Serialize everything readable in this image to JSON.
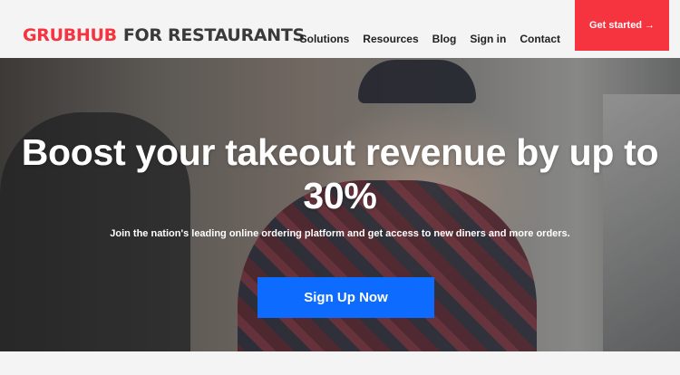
{
  "header": {
    "logo_brand": "GRUBHUB",
    "logo_suffix": "FOR RESTAURANTS",
    "nav": [
      "Solutions",
      "Resources",
      "Blog",
      "Sign in",
      "Contact"
    ],
    "cta_label": "Get started",
    "cta_arrow": "→"
  },
  "hero": {
    "title": "Boost your takeout revenue by up to 30%",
    "subtitle": "Join the nation's leading online ordering platform and get access to new diners and more orders.",
    "button_label": "Sign Up Now"
  },
  "colors": {
    "brand_red": "#f63440",
    "cta_blue": "#0e6bff",
    "header_bg": "#f4f4f4"
  }
}
